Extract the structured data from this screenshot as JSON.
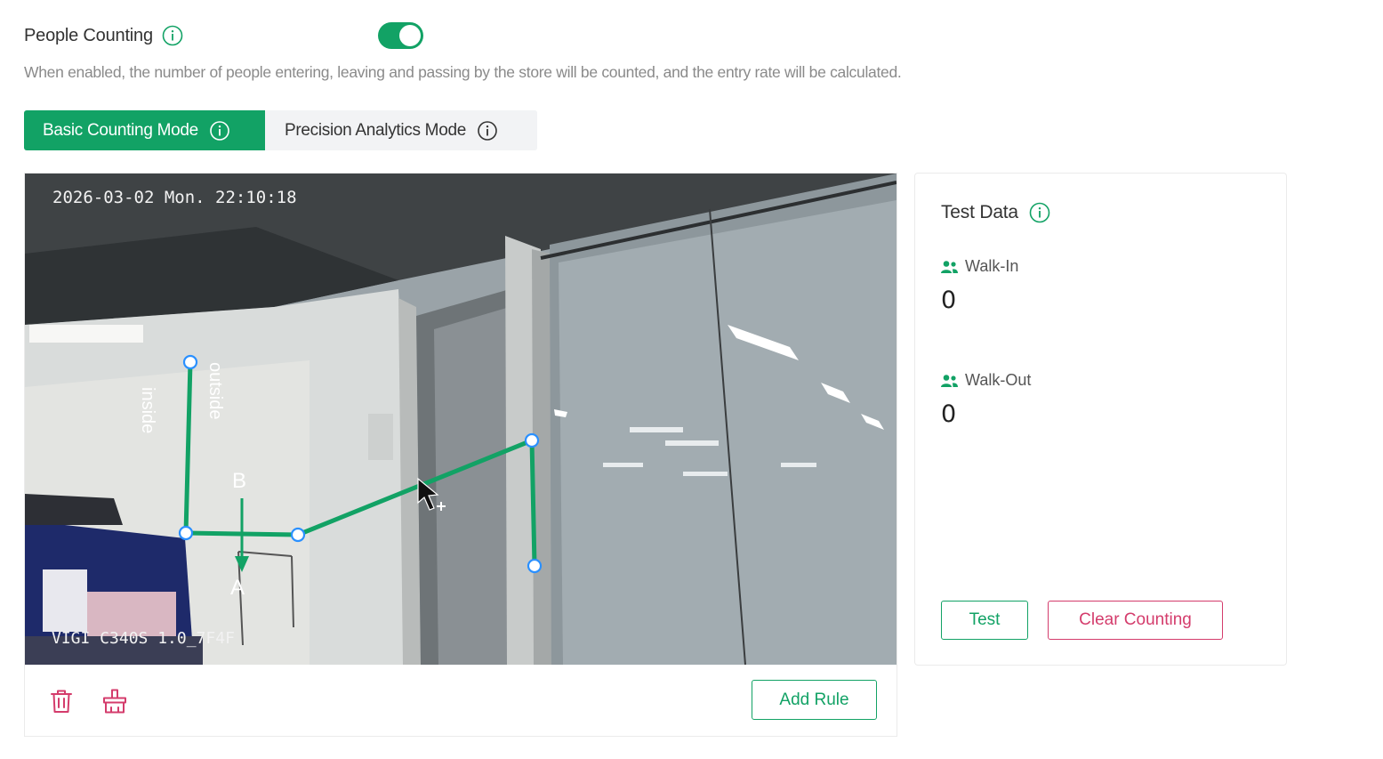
{
  "people_counting": {
    "title": "People Counting",
    "enabled": true,
    "description": "When enabled, the number of people entering, leaving and passing by the store will be counted, and the entry rate will be calculated."
  },
  "modes": {
    "basic_label": "Basic Counting Mode",
    "precision_label": "Precision Analytics Mode",
    "active": "basic"
  },
  "video": {
    "timestamp": "2026-03-02 Mon. 22:10:18",
    "camera_name": "VIGI C340S 1.0_7F4F",
    "line_labels": {
      "inside": "inside",
      "outside": "outside",
      "b": "B",
      "a": "A"
    }
  },
  "actions": {
    "add_rule_label": "Add Rule"
  },
  "test_data": {
    "title": "Test Data",
    "walk_in_label": "Walk-In",
    "walk_in_value": "0",
    "walk_out_label": "Walk-Out",
    "walk_out_value": "0",
    "test_label": "Test",
    "clear_label": "Clear Counting"
  },
  "colors": {
    "accent": "#12a265",
    "danger": "#d43c6c"
  }
}
